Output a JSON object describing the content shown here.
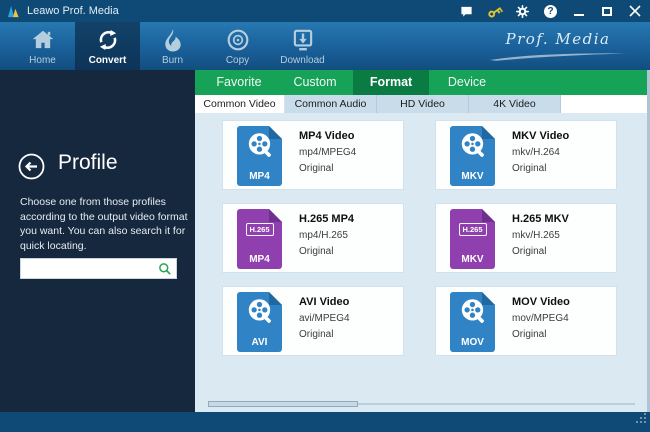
{
  "window": {
    "title": "Leawo Prof. Media"
  },
  "titlebar": {
    "icons": [
      "message",
      "key",
      "gear",
      "help",
      "minimize",
      "maximize",
      "close"
    ]
  },
  "nav": {
    "brand": "Prof. Media",
    "items": [
      {
        "label": "Home",
        "active": false
      },
      {
        "label": "Convert",
        "active": true
      },
      {
        "label": "Burn",
        "active": false
      },
      {
        "label": "Copy",
        "active": false
      },
      {
        "label": "Download",
        "active": false
      }
    ]
  },
  "sidebar": {
    "title": "Profile",
    "description_lines": [
      "Choose one from those profiles",
      "according to the output video format",
      "you want. You can also search it for",
      "quick locating."
    ],
    "search": {
      "value": "",
      "placeholder": ""
    }
  },
  "tabs": {
    "items": [
      {
        "label": "Favorite",
        "active": false
      },
      {
        "label": "Custom",
        "active": false
      },
      {
        "label": "Format",
        "active": true
      },
      {
        "label": "Device",
        "active": false
      }
    ]
  },
  "subtabs": {
    "items": [
      {
        "label": "Common Video",
        "active": true
      },
      {
        "label": "Common Audio",
        "active": false
      },
      {
        "label": "HD Video",
        "active": false
      },
      {
        "label": "4K Video",
        "active": false
      }
    ]
  },
  "profiles": [
    {
      "name": "MP4 Video",
      "format": "mp4/MPEG4",
      "quality": "Original",
      "badge": "MP4",
      "color": "blue",
      "kind": "reel"
    },
    {
      "name": "MKV Video",
      "format": "mkv/H.264",
      "quality": "Original",
      "badge": "MKV",
      "color": "blue",
      "kind": "reel"
    },
    {
      "name": "H.265 MP4",
      "format": "mp4/H.265",
      "quality": "Original",
      "badge": "MP4",
      "color": "purple",
      "kind": "h265",
      "overlay": "H.265"
    },
    {
      "name": "H.265 MKV",
      "format": "mkv/H.265",
      "quality": "Original",
      "badge": "MKV",
      "color": "purple",
      "kind": "h265",
      "overlay": "H.265"
    },
    {
      "name": "AVI Video",
      "format": "avi/MPEG4",
      "quality": "Original",
      "badge": "AVI",
      "color": "blue",
      "kind": "reel"
    },
    {
      "name": "MOV Video",
      "format": "mov/MPEG4",
      "quality": "Original",
      "badge": "MOV",
      "color": "blue",
      "kind": "reel"
    }
  ],
  "colors": {
    "titlebar_blue": "#0e4a75",
    "sidebar_navy": "#16283e",
    "content_bg": "#dbeaf2",
    "accent_green": "#16a257",
    "tab_active_green": "#0a7b42",
    "icon_blue": "#3084c6",
    "icon_blue_fold": "#2268a0",
    "icon_purple": "#9040ae",
    "icon_purple_fold": "#6f2f91",
    "key_yellow": "#e9c431",
    "search_green": "#2aa352"
  }
}
